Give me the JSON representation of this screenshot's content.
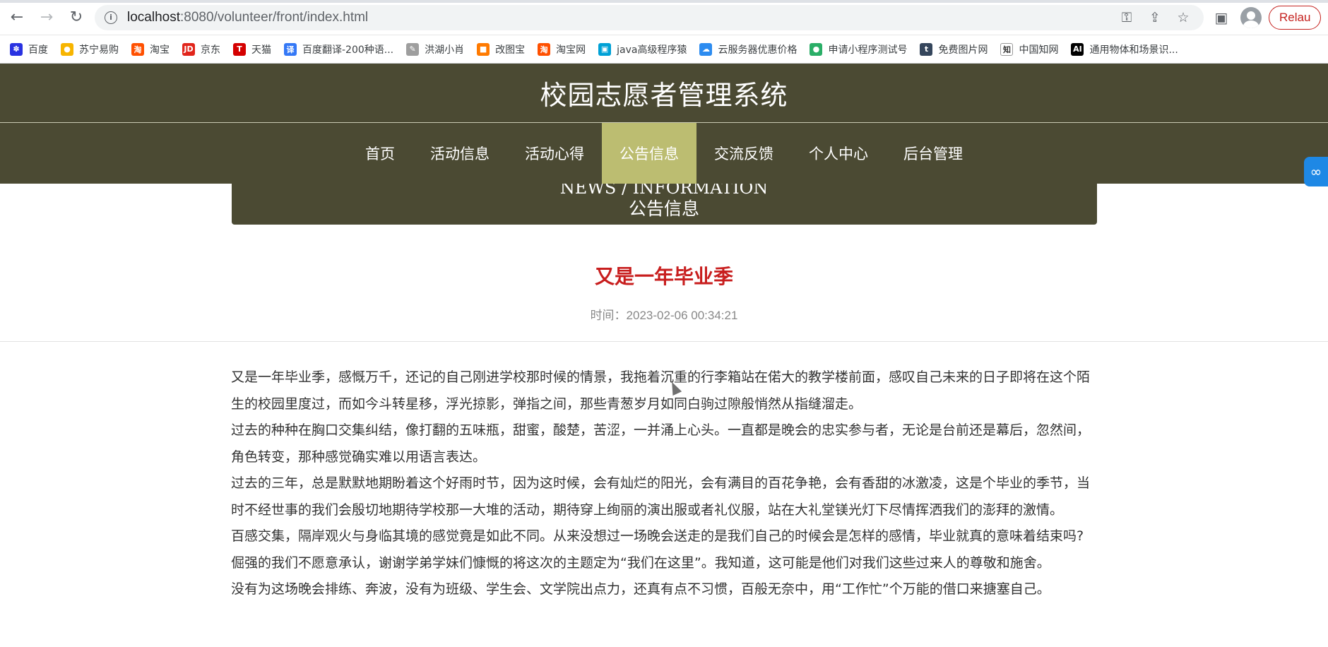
{
  "browser": {
    "url_host": "localhost",
    "url_rest": ":8080/volunteer/front/index.html",
    "relaunch_label": "Relau"
  },
  "bookmarks": [
    {
      "label": "百度",
      "icon": "baidu-icon",
      "color": "#2932e1",
      "glyph": "✽"
    },
    {
      "label": "苏宁易购",
      "icon": "suning-icon",
      "color": "#f7b500",
      "glyph": "●"
    },
    {
      "label": "淘宝",
      "icon": "taobao-icon",
      "color": "#ff5000",
      "glyph": "淘"
    },
    {
      "label": "京东",
      "icon": "jd-icon",
      "color": "#e1251b",
      "glyph": "JD"
    },
    {
      "label": "天猫",
      "icon": "tmall-icon",
      "color": "#d40000",
      "glyph": "T"
    },
    {
      "label": "百度翻译-200种语...",
      "icon": "translate-icon",
      "color": "#3478f6",
      "glyph": "译"
    },
    {
      "label": "洪湖小肖",
      "icon": "hunghu-icon",
      "color": "#9e9e9e",
      "glyph": "✎"
    },
    {
      "label": "改图宝",
      "icon": "gaitubao-icon",
      "color": "#ff7a00",
      "glyph": "■"
    },
    {
      "label": "淘宝网",
      "icon": "taobaowang-icon",
      "color": "#ff5000",
      "glyph": "淘"
    },
    {
      "label": "java高级程序猿",
      "icon": "bilibili-icon",
      "color": "#00a1d6",
      "glyph": "▣"
    },
    {
      "label": "云服务器优惠价格",
      "icon": "cloud-icon",
      "color": "#2d8cf0",
      "glyph": "☁"
    },
    {
      "label": "申请小程序测试号",
      "icon": "wechat-icon",
      "color": "#2aae67",
      "glyph": "●"
    },
    {
      "label": "免费图片网",
      "icon": "tumblr-icon",
      "color": "#35465c",
      "glyph": "t"
    },
    {
      "label": "中国知网",
      "icon": "cnki-icon",
      "color": "#ffffff",
      "glyph": "知"
    },
    {
      "label": "通用物体和场景识...",
      "icon": "ai-icon",
      "color": "#000000",
      "glyph": "AI"
    }
  ],
  "site": {
    "title": "校园志愿者管理系统",
    "nav": [
      "首页",
      "活动信息",
      "活动心得",
      "公告信息",
      "交流反馈",
      "个人中心",
      "后台管理"
    ],
    "active_nav": "公告信息"
  },
  "banner": {
    "en": "NEWS / INFORMATION",
    "cn": "公告信息"
  },
  "article": {
    "title": "又是一年毕业季",
    "time": "时间：2023-02-06 00:34:21",
    "paragraphs": [
      "又是一年毕业季，感慨万千，还记的自己刚进学校那时候的情景，我拖着沉重的行李箱站在偌大的教学楼前面，感叹自己未来的日子即将在这个陌生的校园里度过，而如今斗转星移，浮光掠影，弹指之间，那些青葱岁月如同白驹过隙般悄然从指缝溜走。",
      "过去的种种在胸口交集纠结，像打翻的五味瓶，甜蜜，酸楚，苦涩，一并涌上心头。一直都是晚会的忠实参与者，无论是台前还是幕后，忽然间，角色转变，那种感觉确实难以用语言表达。",
      "过去的三年，总是默默地期盼着这个好雨时节，因为这时候，会有灿烂的阳光，会有满目的百花争艳，会有香甜的冰激凌，这是个毕业的季节，当时不经世事的我们会殷切地期待学校那一大堆的活动，期待穿上绚丽的演出服或者礼仪服，站在大礼堂镁光灯下尽情挥洒我们的澎拜的激情。",
      "百感交集，隔岸观火与身临其境的感觉竟是如此不同。从来没想过一场晚会送走的是我们自己的时候会是怎样的感情，毕业就真的意味着结束吗?倔强的我们不愿意承认，谢谢学弟学妹们慷慨的将这次的主题定为“我们在这里”。我知道，这可能是他们对我们这些过来人的尊敬和施舍。",
      "没有为这场晚会排练、奔波，没有为班级、学生会、文学院出点力，还真有点不习惯，百般无奈中，用“工作忙”个万能的借口来搪塞自己。"
    ]
  },
  "colors": {
    "header_bg": "#4b4a33",
    "nav_active_bg": "#bcbd71",
    "title_red": "#c81e1e"
  }
}
